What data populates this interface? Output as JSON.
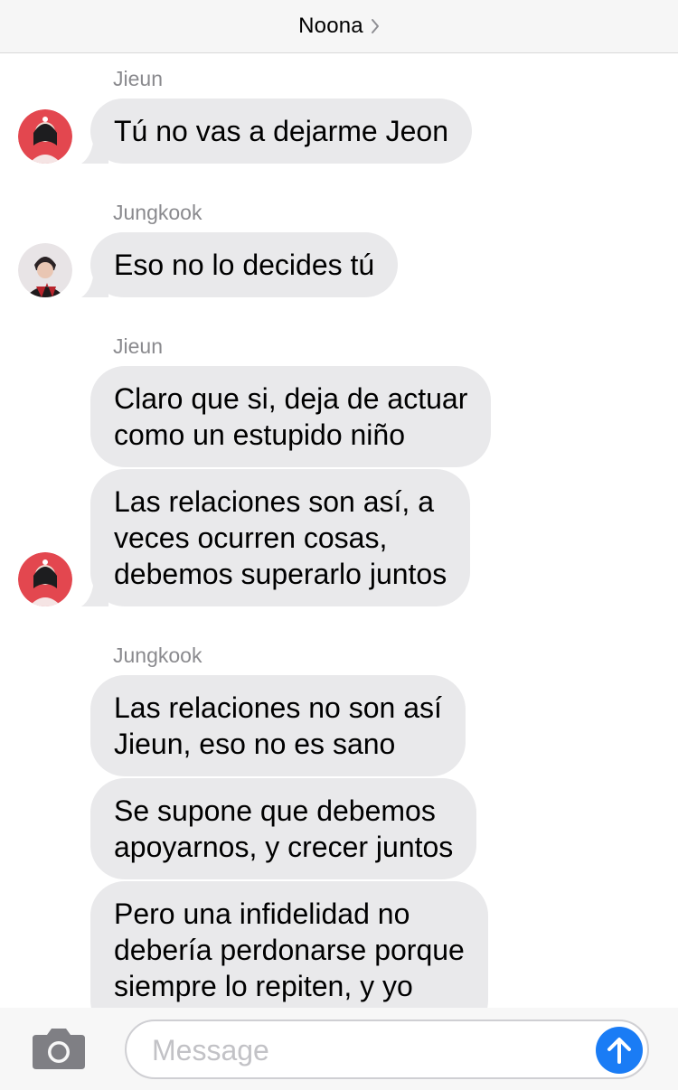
{
  "header": {
    "title": "Noona"
  },
  "messages": [
    {
      "sender": "Jieun",
      "bubbles": [
        "Tú no vas a dejarme Jeon"
      ]
    },
    {
      "sender": "Jungkook",
      "bubbles": [
        "Eso no lo decides tú"
      ]
    },
    {
      "sender": "Jieun",
      "bubbles": [
        "Claro que si, deja de actuar\ncomo un estupido niño",
        "Las relaciones son así, a\nveces ocurren cosas,\ndebemos superarlo juntos"
      ]
    },
    {
      "sender": "Jungkook",
      "bubbles": [
        "Las relaciones no son así\nJieun, eso no es sano",
        "Se supone que debemos\napoyarnos, y crecer juntos",
        "Pero una infidelidad no\ndebería perdonarse porque\nsiempre lo repiten, y yo"
      ]
    }
  ],
  "input": {
    "placeholder": "Message"
  },
  "icons": {
    "camera": "camera-icon",
    "send": "arrow-up-icon",
    "chevron": "chevron-right-icon"
  },
  "colors": {
    "bubble": "#e9e9eb",
    "send": "#1a7cf5",
    "sender": "#8a8a8e"
  }
}
